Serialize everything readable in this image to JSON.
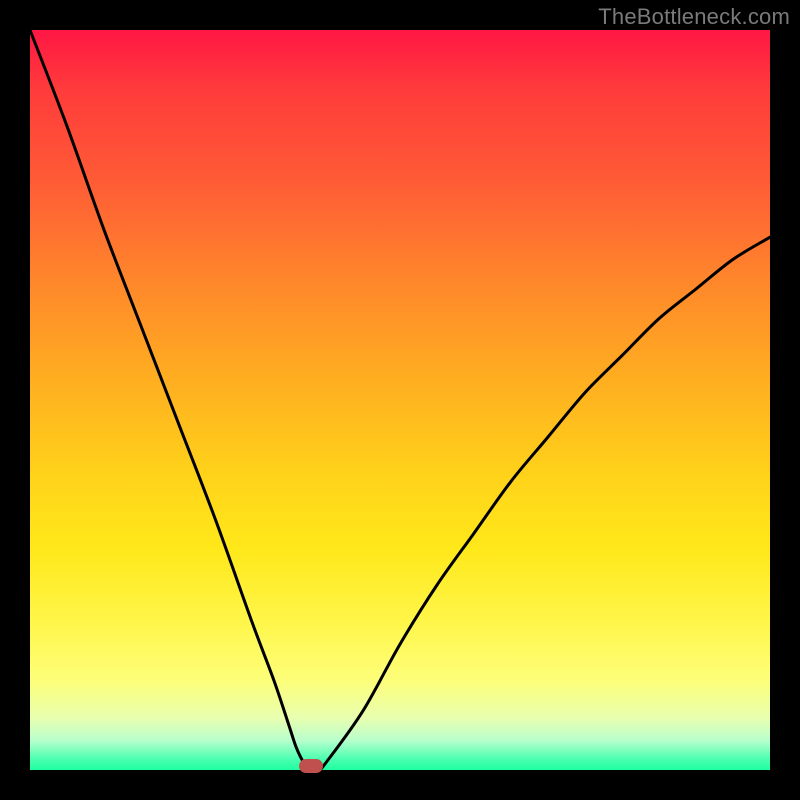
{
  "watermark": "TheBottleneck.com",
  "colors": {
    "frame": "#000000",
    "curve": "#000000",
    "marker": "#c0504d"
  },
  "chart_data": {
    "type": "line",
    "title": "",
    "xlabel": "",
    "ylabel": "",
    "xlim": [
      0,
      100
    ],
    "ylim": [
      0,
      100
    ],
    "grid": false,
    "legend": false,
    "series": [
      {
        "name": "bottleneck-curve",
        "x": [
          0,
          5,
          10,
          15,
          20,
          25,
          30,
          33,
          35,
          36,
          37,
          38,
          39,
          40,
          45,
          50,
          55,
          60,
          65,
          70,
          75,
          80,
          85,
          90,
          95,
          100
        ],
        "y": [
          100,
          87,
          73,
          60,
          47,
          34,
          20,
          12,
          6,
          3,
          1,
          0,
          0,
          1,
          8,
          17,
          25,
          32,
          39,
          45,
          51,
          56,
          61,
          65,
          69,
          72
        ]
      }
    ],
    "marker": {
      "x": 38,
      "y": 0
    },
    "gradient_stops": [
      {
        "pos": 0.0,
        "color": "#ff1744"
      },
      {
        "pos": 0.35,
        "color": "#ff8a2a"
      },
      {
        "pos": 0.7,
        "color": "#ffe81a"
      },
      {
        "pos": 0.97,
        "color": "#b8ffcc"
      },
      {
        "pos": 1.0,
        "color": "#1dffa0"
      }
    ]
  }
}
